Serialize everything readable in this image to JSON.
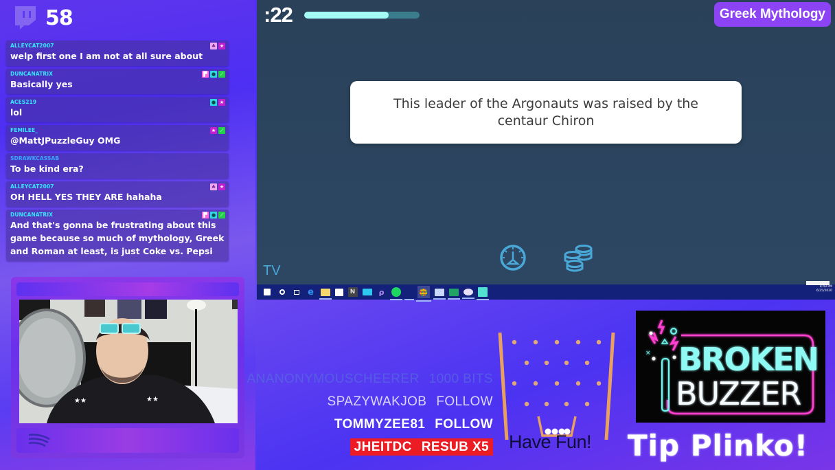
{
  "viewer_count": {
    "icon": "twitch-icon",
    "value": "58"
  },
  "chat": [
    {
      "user": "ALLEYCAT2007",
      "user_color": "cyan",
      "message": "welp first one I am not at all sure about",
      "badges": [
        "pink-light",
        "magenta"
      ]
    },
    {
      "user": "DUNCANATRIX",
      "user_color": "cyan",
      "message": "Basically yes",
      "badges": [
        "pinkbar",
        "cyan",
        "green"
      ]
    },
    {
      "user": "ACES219",
      "user_color": "cyan",
      "message": "lol",
      "badges": [
        "cyan",
        "magenta"
      ]
    },
    {
      "user": "FEMILEE_",
      "user_color": "cyan",
      "message": "@MattJPuzzleGuy OMG",
      "badges": [
        "magenta",
        "green"
      ]
    },
    {
      "user": "SDRAWKCASSAB",
      "user_color": "blue",
      "message": "To be kind era?",
      "badges": []
    },
    {
      "user": "ALLEYCAT2007",
      "user_color": "cyan",
      "message": "OH HELL YES THEY ARE hahaha",
      "badges": [
        "pink-light",
        "magenta"
      ]
    },
    {
      "user": "DUNCANATRIX",
      "user_color": "cyan",
      "message": "And that's gonna be frustrating about this game because so much of mythology, Greek and Roman at least, is just Coke vs. Pepsi",
      "badges": [
        "pinkbar",
        "cyan",
        "green"
      ]
    }
  ],
  "game": {
    "timer": ":22",
    "timer_progress_percent": 73,
    "category": "Greek Mythology",
    "question": "This leader of the Argonauts was raised by the centaur Chiron",
    "footer_label": "TV",
    "icons": [
      "speedometer-icon",
      "coins-icon"
    ]
  },
  "taskbar": {
    "icons": [
      "windows-start-icon",
      "cortana-icon",
      "task-view-icon",
      "edge-icon",
      "file-explorer-icon",
      "store-icon",
      "notion-icon",
      "mail-icon",
      "app-icon",
      "spotify-icon",
      "chrome-icon",
      "window-icon",
      "excel-icon",
      "paint-icon",
      "app2-icon"
    ],
    "time": "8:49 PM",
    "date": "6/25/2020"
  },
  "alerts": [
    {
      "user": "ANANONYMOUSCHEERER",
      "action": "1000 BITS",
      "style": "faded"
    },
    {
      "user": "SPAZYWAKJOB",
      "action": "FOLLOW",
      "style": "light"
    },
    {
      "user": "TOMMYZEE81",
      "action": "FOLLOW",
      "style": "white"
    },
    {
      "user": "JHEITDC",
      "action": "RESUB X5",
      "style": "red"
    }
  ],
  "plinko": {
    "label": "Have Fun!"
  },
  "logo": {
    "line1": "BROKEN",
    "line2": "BUZZER"
  },
  "tip_label": "Tip Plinko!",
  "colors": {
    "accent_purple": "#8b43f4",
    "timer_fill": "#a4fbf6",
    "game_bg": "#2c4460",
    "alert_red": "#ec1c24",
    "neon_cyan": "#6ff7f0",
    "neon_pink": "#ff3fd0"
  }
}
